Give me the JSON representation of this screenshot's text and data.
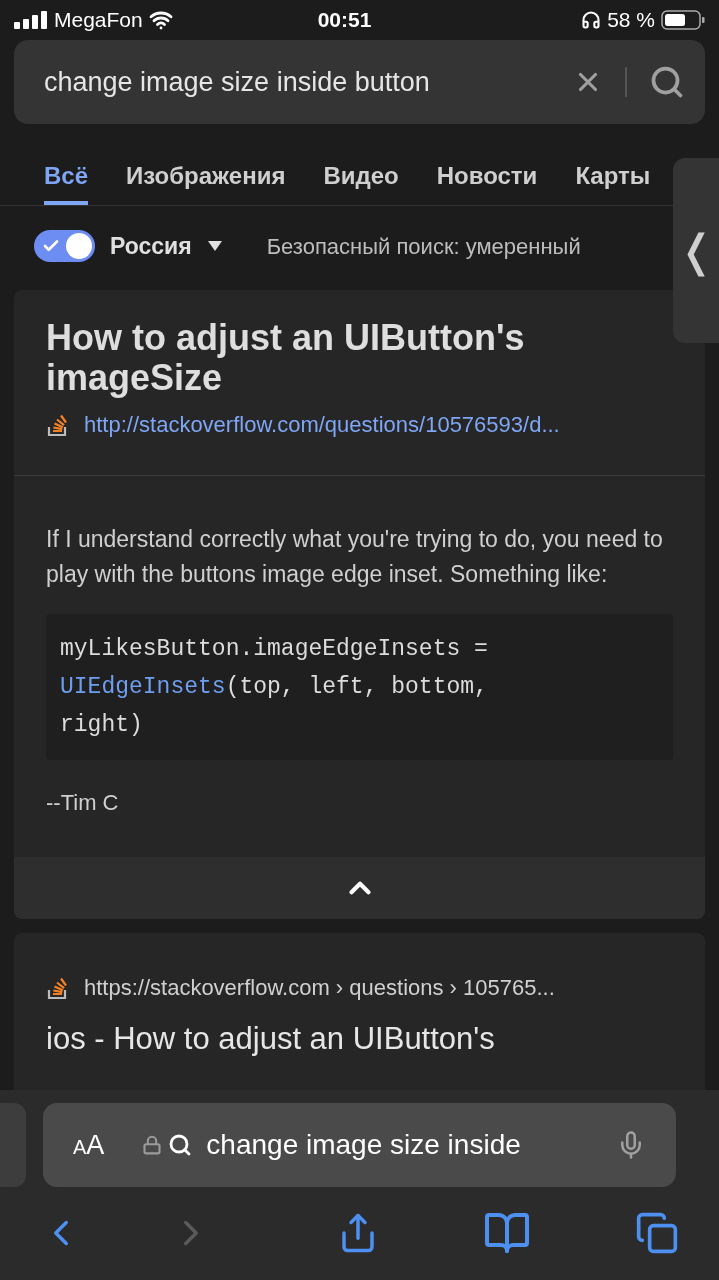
{
  "status_bar": {
    "carrier": "MegaFon",
    "time": "00:51",
    "battery": "58 %"
  },
  "search": {
    "value": "change image size inside button"
  },
  "tabs": [
    {
      "label": "Всё",
      "selected": true
    },
    {
      "label": "Изображения",
      "selected": false
    },
    {
      "label": "Видео",
      "selected": false
    },
    {
      "label": "Новости",
      "selected": false
    },
    {
      "label": "Карты",
      "selected": false
    }
  ],
  "filters": {
    "region_on": true,
    "region": "Россия",
    "safe_search": "Безопасный поиск: умеренный"
  },
  "side_handle": {
    "glyph": "❬"
  },
  "answer_card": {
    "title": "How to adjust an UIButton's imageSize",
    "url": "http://stackoverflow.com/questions/10576593/d...",
    "snippet": "If I understand correctly what you're trying to do, you need to play with the buttons image edge inset. Something like:",
    "code": [
      [
        {
          "text": "myLikesButton.imageEdgeInsets =",
          "kind": "plain"
        }
      ],
      [
        {
          "text": "UIEdgeInsets",
          "kind": "type"
        },
        {
          "text": "(top, left, bottom,",
          "kind": "plain"
        }
      ],
      [
        {
          "text": "right)",
          "kind": "plain"
        }
      ]
    ],
    "signature": "--Tim C",
    "expanded": true
  },
  "result": {
    "url": "https://stackoverflow.com › questions › 105765...",
    "title": "ios - How to adjust an UIButton's"
  },
  "browser_bar": {
    "text_size": "AA",
    "address": "change image size inside",
    "back_enabled": true,
    "forward_enabled": false
  }
}
